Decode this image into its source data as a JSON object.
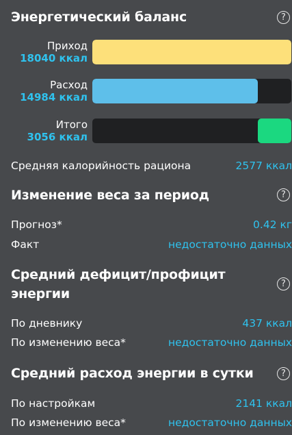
{
  "energy_balance": {
    "title": "Энергетический баланс",
    "bars": [
      {
        "name": "Приход",
        "value": "18040 ккал",
        "fraction": 1.0,
        "color": "#fde07a",
        "align": "left"
      },
      {
        "name": "Расход",
        "value": "14984 ккал",
        "fraction": 0.83,
        "color": "#5ebfea",
        "align": "left"
      },
      {
        "name": "Итого",
        "value": "3056 ккал",
        "fraction": 0.17,
        "color": "#1bd880",
        "align": "right"
      }
    ],
    "avg_label": "Средняя калорийность рациона",
    "avg_value": "2577 ккал"
  },
  "weight_change": {
    "title": "Изменение веса за период",
    "rows": [
      {
        "label": "Прогноз*",
        "value": "0.42 кг"
      },
      {
        "label": "Факт",
        "value": "недостаточно данных"
      }
    ]
  },
  "deficit": {
    "title_line1": "Средний дефицит/профицит",
    "title_line2": "энергии",
    "rows": [
      {
        "label": "По дневнику",
        "value": "437 ккал"
      },
      {
        "label": "По изменению веса*",
        "value": "недостаточно данных"
      }
    ]
  },
  "expenditure": {
    "title": "Средний расход энергии в сутки",
    "rows": [
      {
        "label": "По настройкам",
        "value": "2141 ккал"
      },
      {
        "label": "По изменению веса*",
        "value": "недостаточно данных"
      }
    ]
  },
  "help_glyph": "?"
}
